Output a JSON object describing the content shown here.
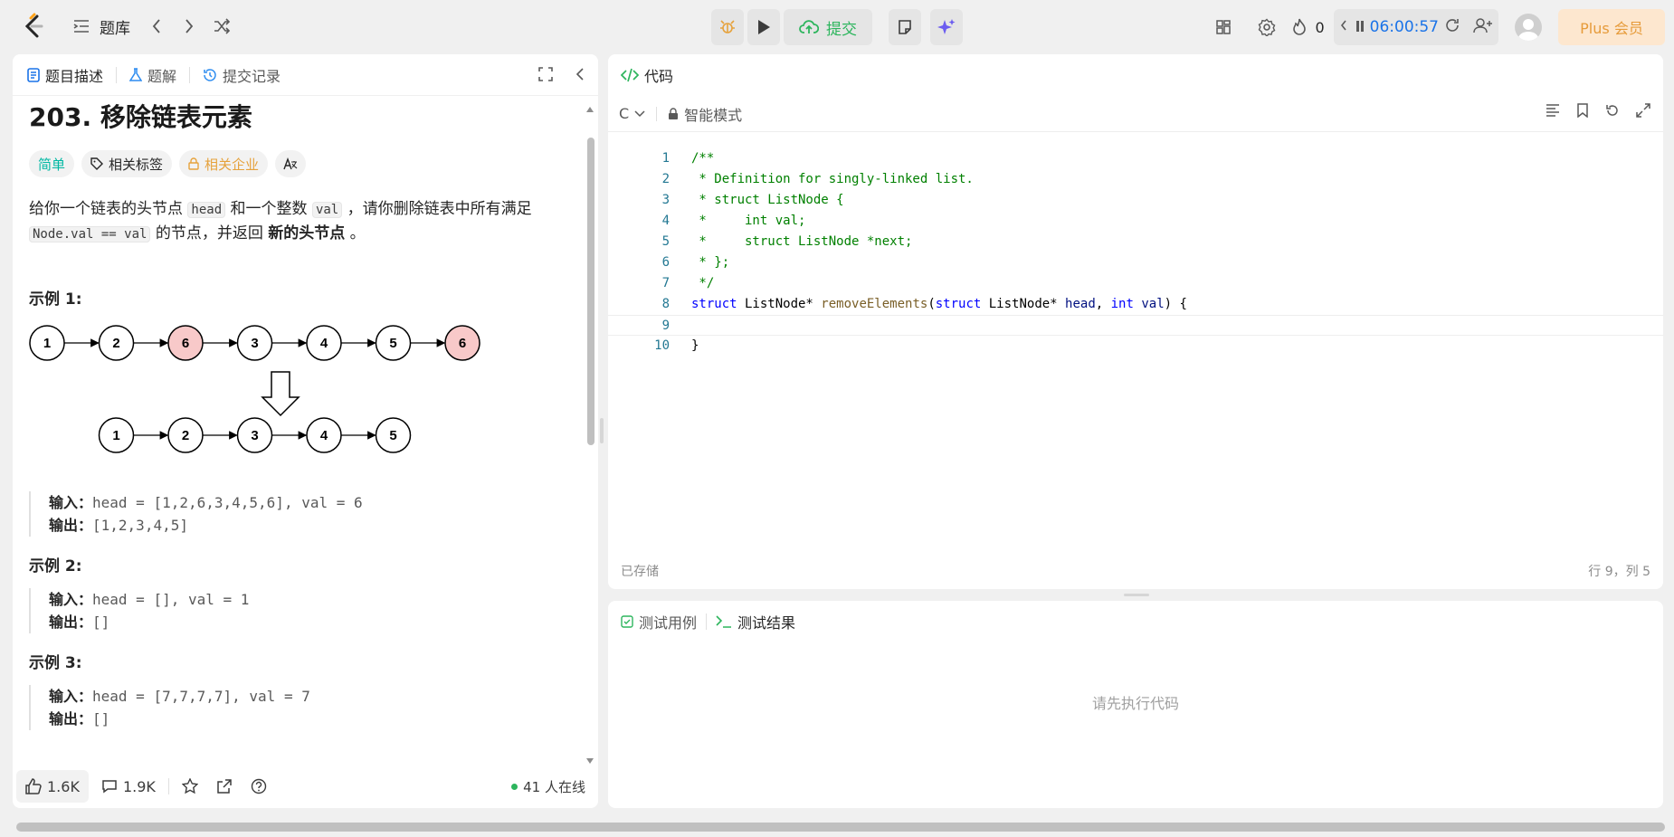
{
  "topbar": {
    "problem_list_label": "题库",
    "submit_label": "提交",
    "streak_count": "0",
    "timer": "06:00:57",
    "plus_label": "Plus 会员"
  },
  "left": {
    "tabs": [
      "题目描述",
      "题解",
      "提交记录"
    ],
    "title": "203. 移除链表元素",
    "tags": [
      "简单",
      "相关标签",
      "相关企业"
    ],
    "desc": {
      "p1": "给你一个链表的头节点 ",
      "code_head": "head",
      "p2": " 和一个整数 ",
      "code_val": "val",
      "p3": " ，请你删除链表中所有满足 ",
      "code_cond": "Node.val == val",
      "p4": " 的节点，并返回 ",
      "bold": "新的头节点",
      "p5": " 。"
    },
    "examples": [
      {
        "title": "示例 1:",
        "input_label": "输入：",
        "input": "head = [1,2,6,3,4,5,6], val = 6",
        "output_label": "输出：",
        "output": "[1,2,3,4,5]"
      },
      {
        "title": "示例 2:",
        "input_label": "输入：",
        "input": "head = [], val = 1",
        "output_label": "输出：",
        "output": "[]"
      },
      {
        "title": "示例 3:",
        "input_label": "输入：",
        "input": "head = [7,7,7,7], val = 7",
        "output_label": "输出：",
        "output": "[]"
      }
    ],
    "diagram": {
      "top_row": [
        "1",
        "2",
        "6",
        "3",
        "4",
        "5",
        "6"
      ],
      "bottom_row": [
        "1",
        "2",
        "3",
        "4",
        "5"
      ],
      "removed_color": "#f8c9c9"
    },
    "footer": {
      "likes": "1.6K",
      "comments": "1.9K",
      "online": "41 人在线"
    }
  },
  "code": {
    "tab_label": "代码",
    "language": "C",
    "mode": "智能模式",
    "saved": "已存储",
    "cursor": "行 9，列 5",
    "line_numbers": [
      "1",
      "2",
      "3",
      "4",
      "5",
      "6",
      "7",
      "8",
      "9",
      "10"
    ]
  },
  "test": {
    "tab_cases": "测试用例",
    "tab_results": "测试结果",
    "empty": "请先执行代码"
  }
}
